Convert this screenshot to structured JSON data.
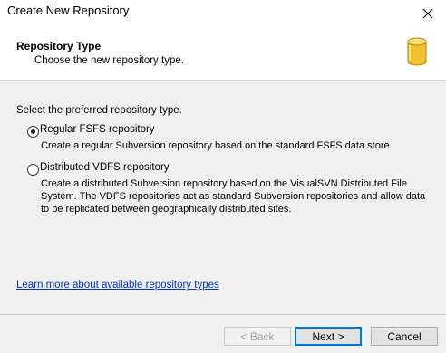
{
  "window": {
    "title": "Create New Repository"
  },
  "header": {
    "title": "Repository Type",
    "subtitle": "Choose the new repository type.",
    "icon": "database-icon"
  },
  "instruction": "Select the preferred repository type.",
  "options": [
    {
      "label": "Regular FSFS repository",
      "selected": true,
      "description": "Create a regular Subversion repository based on the standard FSFS data store."
    },
    {
      "label": "Distributed VDFS repository",
      "selected": false,
      "description_lines": [
        "Create a distributed Subversion repository based on the VisualSVN Distributed File",
        "System. The VDFS repositories act as standard Subversion repositories and allow data",
        "to be replicated between geographically distributed sites."
      ]
    }
  ],
  "help_link": "Learn more about available repository types",
  "buttons": {
    "back": "< Back",
    "next": "Next >",
    "cancel": "Cancel"
  },
  "colors": {
    "link": "#0033cc",
    "focus": "#0078d7",
    "icon_gold": "#f2c12e"
  }
}
